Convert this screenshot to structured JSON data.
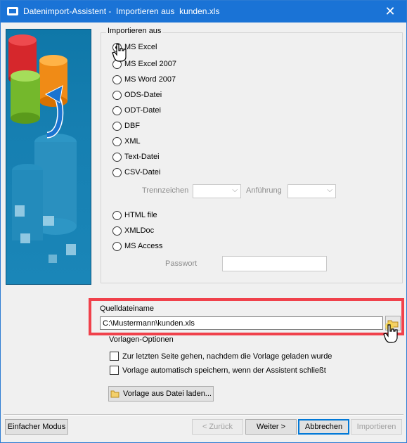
{
  "window": {
    "title": "Datenimport-Assistent -  Importieren aus  kunden.xls",
    "close_icon": "close-icon",
    "accent": "#1a73d6"
  },
  "import_group": {
    "title": "Importieren aus",
    "options": [
      {
        "label": "MS Excel",
        "checked": true
      },
      {
        "label": "MS Excel 2007",
        "checked": false
      },
      {
        "label": "MS Word 2007",
        "checked": false
      },
      {
        "label": "ODS-Datei",
        "checked": false
      },
      {
        "label": "ODT-Datei",
        "checked": false
      },
      {
        "label": "DBF",
        "checked": false
      },
      {
        "label": "XML",
        "checked": false
      },
      {
        "label": "Text-Datei",
        "checked": false
      },
      {
        "label": "CSV-Datei",
        "checked": false
      }
    ],
    "csv": {
      "delimiter_label": "Trennzeichen",
      "quote_label": "Anführung"
    },
    "options2": [
      {
        "label": "HTML file",
        "checked": false
      },
      {
        "label": "XMLDoc",
        "checked": false
      },
      {
        "label": "MS Access",
        "checked": false
      }
    ],
    "password_label": "Passwort"
  },
  "source_file": {
    "label": "Quelldateiname",
    "value": "C:\\Mustermann\\kunden.xls",
    "browse_icon": "folder-icon",
    "highlight_color": "#f0414b"
  },
  "template_options": {
    "title": "Vorlagen-Optionen",
    "checkbox1": "Zur letzten Seite gehen, nachdem die Vorlage geladen wurde",
    "checkbox2": "Vorlage automatisch speichern, wenn der Assistent schließt",
    "load_button": "Vorlage aus Datei laden..."
  },
  "footer": {
    "simple_mode": "Einfacher Modus",
    "back": "< Zurück",
    "next": "Weiter >",
    "cancel": "Abbrechen",
    "import": "Importieren"
  }
}
